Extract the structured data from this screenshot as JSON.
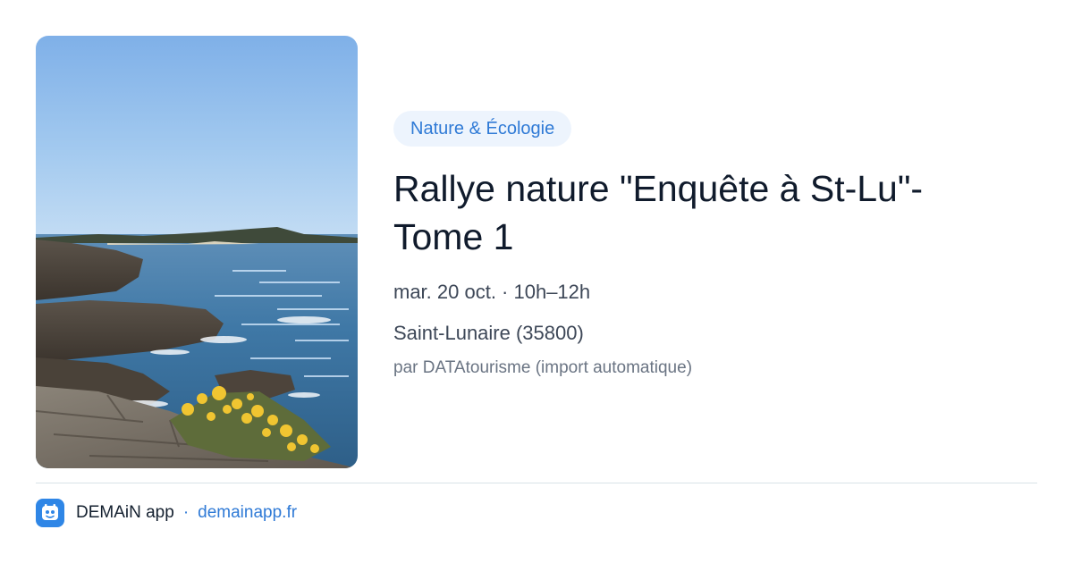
{
  "event": {
    "category": "Nature & Écologie",
    "title": "Rallye nature \"Enquête à St-Lu\"- Tome 1",
    "date": "mar. 20 oct. · 10h–12h",
    "location": "Saint-Lunaire (35800)",
    "source": "par DATAtourisme (import automatique)",
    "image": "coastal-landscape-photo"
  },
  "footer": {
    "app_name": "DEMAiN app",
    "separator": "·",
    "site": "demainapp.fr",
    "logo_icon": "demain-logo-icon"
  },
  "colors": {
    "accent": "#2f7ad6",
    "tag_background": "#edf4fd",
    "title": "#101b2c",
    "meta": "#3d4757",
    "muted": "#6a7483",
    "logo": "#2f86e6"
  }
}
